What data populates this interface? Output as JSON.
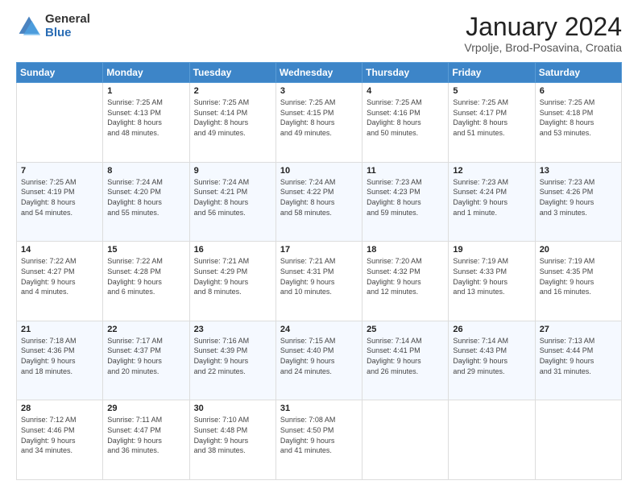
{
  "header": {
    "logo_general": "General",
    "logo_blue": "Blue",
    "month_title": "January 2024",
    "location": "Vrpolje, Brod-Posavina, Croatia"
  },
  "days_of_week": [
    "Sunday",
    "Monday",
    "Tuesday",
    "Wednesday",
    "Thursday",
    "Friday",
    "Saturday"
  ],
  "weeks": [
    [
      {
        "day": "",
        "info": ""
      },
      {
        "day": "1",
        "info": "Sunrise: 7:25 AM\nSunset: 4:13 PM\nDaylight: 8 hours\nand 48 minutes."
      },
      {
        "day": "2",
        "info": "Sunrise: 7:25 AM\nSunset: 4:14 PM\nDaylight: 8 hours\nand 49 minutes."
      },
      {
        "day": "3",
        "info": "Sunrise: 7:25 AM\nSunset: 4:15 PM\nDaylight: 8 hours\nand 49 minutes."
      },
      {
        "day": "4",
        "info": "Sunrise: 7:25 AM\nSunset: 4:16 PM\nDaylight: 8 hours\nand 50 minutes."
      },
      {
        "day": "5",
        "info": "Sunrise: 7:25 AM\nSunset: 4:17 PM\nDaylight: 8 hours\nand 51 minutes."
      },
      {
        "day": "6",
        "info": "Sunrise: 7:25 AM\nSunset: 4:18 PM\nDaylight: 8 hours\nand 53 minutes."
      }
    ],
    [
      {
        "day": "7",
        "info": "Sunrise: 7:25 AM\nSunset: 4:19 PM\nDaylight: 8 hours\nand 54 minutes."
      },
      {
        "day": "8",
        "info": "Sunrise: 7:24 AM\nSunset: 4:20 PM\nDaylight: 8 hours\nand 55 minutes."
      },
      {
        "day": "9",
        "info": "Sunrise: 7:24 AM\nSunset: 4:21 PM\nDaylight: 8 hours\nand 56 minutes."
      },
      {
        "day": "10",
        "info": "Sunrise: 7:24 AM\nSunset: 4:22 PM\nDaylight: 8 hours\nand 58 minutes."
      },
      {
        "day": "11",
        "info": "Sunrise: 7:23 AM\nSunset: 4:23 PM\nDaylight: 8 hours\nand 59 minutes."
      },
      {
        "day": "12",
        "info": "Sunrise: 7:23 AM\nSunset: 4:24 PM\nDaylight: 9 hours\nand 1 minute."
      },
      {
        "day": "13",
        "info": "Sunrise: 7:23 AM\nSunset: 4:26 PM\nDaylight: 9 hours\nand 3 minutes."
      }
    ],
    [
      {
        "day": "14",
        "info": "Sunrise: 7:22 AM\nSunset: 4:27 PM\nDaylight: 9 hours\nand 4 minutes."
      },
      {
        "day": "15",
        "info": "Sunrise: 7:22 AM\nSunset: 4:28 PM\nDaylight: 9 hours\nand 6 minutes."
      },
      {
        "day": "16",
        "info": "Sunrise: 7:21 AM\nSunset: 4:29 PM\nDaylight: 9 hours\nand 8 minutes."
      },
      {
        "day": "17",
        "info": "Sunrise: 7:21 AM\nSunset: 4:31 PM\nDaylight: 9 hours\nand 10 minutes."
      },
      {
        "day": "18",
        "info": "Sunrise: 7:20 AM\nSunset: 4:32 PM\nDaylight: 9 hours\nand 12 minutes."
      },
      {
        "day": "19",
        "info": "Sunrise: 7:19 AM\nSunset: 4:33 PM\nDaylight: 9 hours\nand 13 minutes."
      },
      {
        "day": "20",
        "info": "Sunrise: 7:19 AM\nSunset: 4:35 PM\nDaylight: 9 hours\nand 16 minutes."
      }
    ],
    [
      {
        "day": "21",
        "info": "Sunrise: 7:18 AM\nSunset: 4:36 PM\nDaylight: 9 hours\nand 18 minutes."
      },
      {
        "day": "22",
        "info": "Sunrise: 7:17 AM\nSunset: 4:37 PM\nDaylight: 9 hours\nand 20 minutes."
      },
      {
        "day": "23",
        "info": "Sunrise: 7:16 AM\nSunset: 4:39 PM\nDaylight: 9 hours\nand 22 minutes."
      },
      {
        "day": "24",
        "info": "Sunrise: 7:15 AM\nSunset: 4:40 PM\nDaylight: 9 hours\nand 24 minutes."
      },
      {
        "day": "25",
        "info": "Sunrise: 7:14 AM\nSunset: 4:41 PM\nDaylight: 9 hours\nand 26 minutes."
      },
      {
        "day": "26",
        "info": "Sunrise: 7:14 AM\nSunset: 4:43 PM\nDaylight: 9 hours\nand 29 minutes."
      },
      {
        "day": "27",
        "info": "Sunrise: 7:13 AM\nSunset: 4:44 PM\nDaylight: 9 hours\nand 31 minutes."
      }
    ],
    [
      {
        "day": "28",
        "info": "Sunrise: 7:12 AM\nSunset: 4:46 PM\nDaylight: 9 hours\nand 34 minutes."
      },
      {
        "day": "29",
        "info": "Sunrise: 7:11 AM\nSunset: 4:47 PM\nDaylight: 9 hours\nand 36 minutes."
      },
      {
        "day": "30",
        "info": "Sunrise: 7:10 AM\nSunset: 4:48 PM\nDaylight: 9 hours\nand 38 minutes."
      },
      {
        "day": "31",
        "info": "Sunrise: 7:08 AM\nSunset: 4:50 PM\nDaylight: 9 hours\nand 41 minutes."
      },
      {
        "day": "",
        "info": ""
      },
      {
        "day": "",
        "info": ""
      },
      {
        "day": "",
        "info": ""
      }
    ]
  ]
}
